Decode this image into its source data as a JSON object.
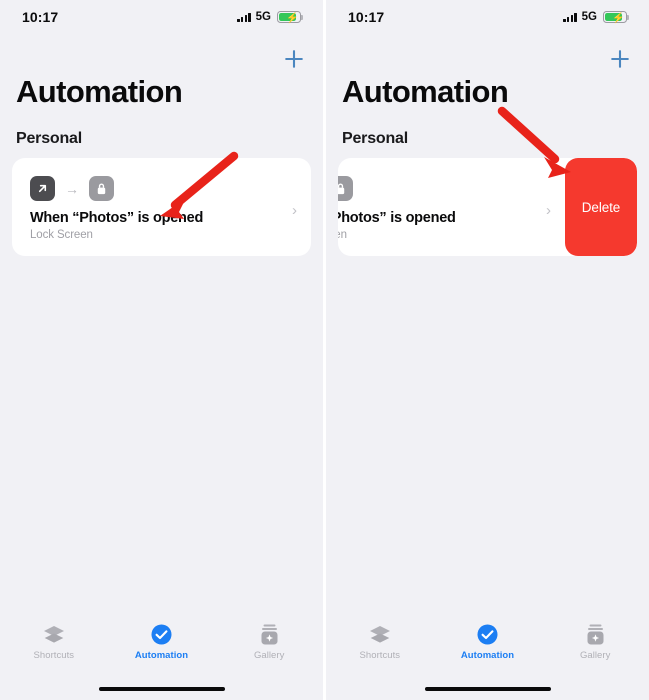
{
  "app": {
    "name": "Shortcuts",
    "accent_blue": "#1c7ef3",
    "delete_red": "#f5392e",
    "battery_green": "#34c759"
  },
  "panels": [
    {
      "id": "left",
      "state": "normal",
      "status_bar": {
        "time": "10:17",
        "network": "5G",
        "signal_icon": "cellular-signal-icon",
        "battery_icon": "battery-charging-icon"
      },
      "add_button": {
        "icon": "plus-icon",
        "label": "+"
      },
      "page_title": "Automation",
      "section_header": "Personal",
      "card": {
        "trigger_icon": "open-app-icon",
        "arrow_icon": "arrow-right-icon",
        "action_icon": "lock-icon",
        "title": "When “Photos” is opened",
        "subtitle": "Lock Screen",
        "chevron": "›"
      },
      "annotation": {
        "type": "arrow",
        "direction": "down-left",
        "color": "#e8231a"
      },
      "tabs": [
        {
          "label": "Shortcuts",
          "icon": "layers-icon",
          "active": false
        },
        {
          "label": "Automation",
          "icon": "check-circle-icon",
          "active": true
        },
        {
          "label": "Gallery",
          "icon": "gallery-jar-icon",
          "active": false
        }
      ]
    },
    {
      "id": "right",
      "state": "swiped",
      "status_bar": {
        "time": "10:17",
        "network": "5G",
        "signal_icon": "cellular-signal-icon",
        "battery_icon": "battery-charging-icon"
      },
      "add_button": {
        "icon": "plus-icon",
        "label": "+"
      },
      "page_title": "Automation",
      "section_header": "Personal",
      "card": {
        "action_icon": "lock-icon",
        "title": "’Photos” is opened",
        "subtitle": "een",
        "chevron": "›",
        "delete_label": "Delete"
      },
      "annotation": {
        "type": "arrow",
        "direction": "down-right",
        "color": "#e8231a"
      },
      "tabs": [
        {
          "label": "Shortcuts",
          "icon": "layers-icon",
          "active": false
        },
        {
          "label": "Automation",
          "icon": "check-circle-icon",
          "active": true
        },
        {
          "label": "Gallery",
          "icon": "gallery-jar-icon",
          "active": false
        }
      ]
    }
  ]
}
